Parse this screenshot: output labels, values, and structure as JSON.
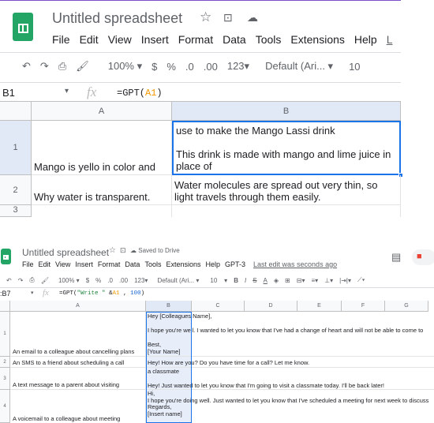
{
  "top": {
    "title": "Untitled spreadsheet",
    "menu": [
      "File",
      "Edit",
      "View",
      "Insert",
      "Format",
      "Data",
      "Tools",
      "Extensions",
      "Help",
      "L"
    ],
    "toolbar": {
      "zoom": "100%",
      "currency": "$",
      "percent": "%",
      "dec_less": ".0",
      "dec_more": ".00",
      "format": "123",
      "font": "Default (Ari...",
      "size": "10"
    },
    "cell_ref": "B1",
    "fx": "fx",
    "formula_prefix": "=GPT(",
    "formula_ref": "A1",
    "formula_suffix": ")",
    "columns": [
      "A",
      "B"
    ],
    "rows": [
      {
        "num": "1",
        "a": "Mango is yello in color and",
        "b": "use to make the Mango Lassi drink\n\nThis drink is made with mango and lime juice in place of"
      },
      {
        "num": "2",
        "a": "Why water is transparent.",
        "b": "Water molecules are spread out very thin, so light travels through them easily."
      },
      {
        "num": "3",
        "a": "",
        "b": ""
      }
    ]
  },
  "bottom": {
    "title": "Untitled spreadsheet",
    "saved": "Saved to Drive",
    "menu": [
      "File",
      "Edit",
      "View",
      "Insert",
      "Format",
      "Data",
      "Tools",
      "Extensions",
      "Help",
      "GPT-3"
    ],
    "last_edit": "Last edit was seconds ago",
    "toolbar": {
      "zoom": "100%",
      "currency": "$",
      "percent": "%",
      "dec_less": ".0",
      "dec_more": ".00",
      "format": "123",
      "font": "Default (Ari...",
      "size": "10"
    },
    "cell_ref": ":B7",
    "fx": "fx",
    "formula_prefix": "=GPT(",
    "formula_string": "\"Write \"",
    "formula_mid": " &",
    "formula_ref": "A1",
    "formula_sep": " , ",
    "formula_num": "100",
    "formula_suffix": ")",
    "columns": [
      "A",
      "B",
      "C",
      "D",
      "E",
      "F",
      "G"
    ],
    "rows": [
      {
        "num": "1",
        "a": "An email to a colleague about cancelling plans",
        "b": "Hey [Colleagues Name],\n\nI hope you're well. I wanted to let you know that I've had a change of heart and will not be able to come to\n\nBest,\n[Your Name]"
      },
      {
        "num": "2",
        "a": "An SMS to a friend about scheduling a call",
        "b": "Hey! How are you? Do you have time for a call? Let me know."
      },
      {
        "num": "3",
        "a": "A text message to a parent about visiting",
        "b": "a classmate\n\nHey! Just wanted to let you know that I'm going to visit a classmate today. I'll be back later!"
      },
      {
        "num": "4",
        "a": "A voicemail to a colleague about meeting",
        "b": "Hi,\nI hope you're doing well. Just wanted to let you know that I've scheduled a meeting for next week to discuss\nRegards,\n[Insert name]"
      }
    ]
  },
  "colors": {
    "accent": "#1a73e8",
    "logo": "#23a566",
    "ref": "#f29900"
  }
}
